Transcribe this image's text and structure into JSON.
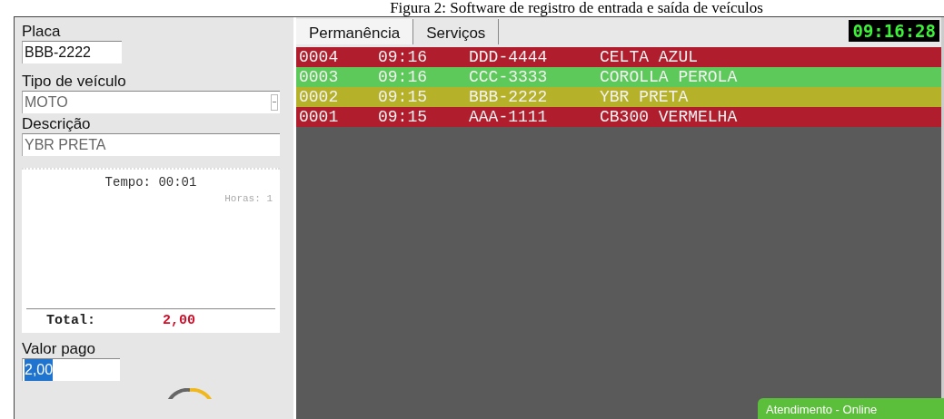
{
  "caption": "Figura 2: Software de registro de entrada e saída de veículos",
  "form": {
    "placa_label": "Placa",
    "placa_value": "BBB-2222",
    "tipo_label": "Tipo de veículo",
    "tipo_value": "MOTO",
    "descricao_label": "Descrição",
    "descricao_value": "YBR PRETA"
  },
  "receipt": {
    "tempo": "Tempo: 00:01",
    "horas": "Horas: 1",
    "total_label": "Total:",
    "total_value": "2,00"
  },
  "payment": {
    "label": "Valor pago",
    "value": "2,00",
    "value_selected": true
  },
  "tabs": [
    {
      "label": "Permanência",
      "selected": true
    },
    {
      "label": "Serviços",
      "selected": false
    }
  ],
  "clock": "09:16:28",
  "rows": [
    {
      "cells": [
        "0004",
        "09:16",
        "DDD-4444",
        "CELTA AZUL"
      ],
      "color": "#b01e2e"
    },
    {
      "cells": [
        "0003",
        "09:16",
        "CCC-3333",
        "COROLLA PEROLA"
      ],
      "color": "#5cc95a"
    },
    {
      "cells": [
        "0002",
        "09:15",
        "BBB-2222",
        "YBR PRETA"
      ],
      "color": "#b5b22a"
    },
    {
      "cells": [
        "0001",
        "09:15",
        "AAA-1111",
        "CB300 VERMELHA"
      ],
      "color": "#b01e2e"
    }
  ],
  "status": "Atendimento - Online"
}
